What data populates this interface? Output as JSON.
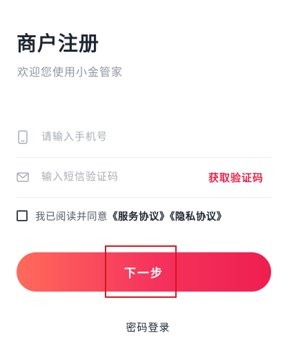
{
  "header": {
    "title": "商户注册",
    "subtitle": "欢迎您使用小金管家"
  },
  "form": {
    "phone": {
      "placeholder": "请输入手机号",
      "value": "",
      "icon": "phone-icon"
    },
    "code": {
      "placeholder": "输入短信验证码",
      "value": "",
      "icon": "envelope-icon",
      "get_code_label": "获取验证码"
    }
  },
  "agreement": {
    "checked": false,
    "prefix": "我已阅读并同意",
    "service_link": "《服务协议》",
    "privacy_link": "《隐私协议》"
  },
  "actions": {
    "next_label": "下一步",
    "password_login_label": "密码登录"
  },
  "colors": {
    "accent": "#e6274b",
    "button_start": "#ff6a5b",
    "button_end": "#ee1f4f",
    "highlight": "#d6141c"
  }
}
